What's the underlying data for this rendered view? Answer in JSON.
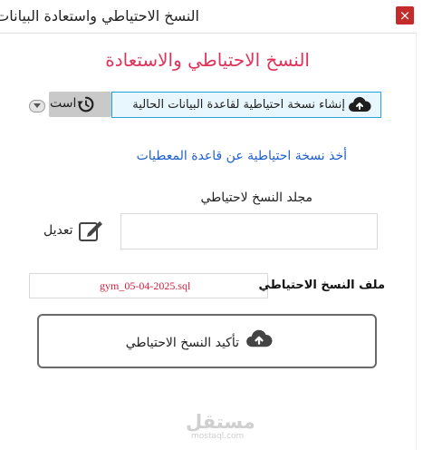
{
  "window": {
    "title": "النسخ الاحتياطي واستعادة البيانات",
    "close_label": "×"
  },
  "heading": "النسخ الاحتياطي والاستعادة",
  "tabs": {
    "create_label": "إنشاء نسخة احتياطية لقاعدة البيانات الحالية",
    "restore_label": "است"
  },
  "link_text": "أخذ نسخة احتياطية عن قاعدة المعطيات",
  "folder": {
    "label": "مجلد النسخ لاحتياطي",
    "value": "",
    "edit_label": "تعديل"
  },
  "file": {
    "label": "ملف النسخ الاحتياطي",
    "value": "gym_05-04-2025.sql"
  },
  "confirm_label": "تأكيد النسخ الاحتياطي",
  "watermark": {
    "brand": "مستقل",
    "sub": "mostaql.com"
  },
  "colors": {
    "heading": "#e0335a",
    "link": "#1f5fcf",
    "file_value": "#d21f3c",
    "tab_active_border": "#2aa4d8",
    "close_button": "#c42b2b"
  },
  "icons": {
    "create_tab": "cloud-upload-icon",
    "restore_tab": "restore-icon",
    "edit": "edit-icon",
    "confirm": "cloud-upload-icon"
  }
}
